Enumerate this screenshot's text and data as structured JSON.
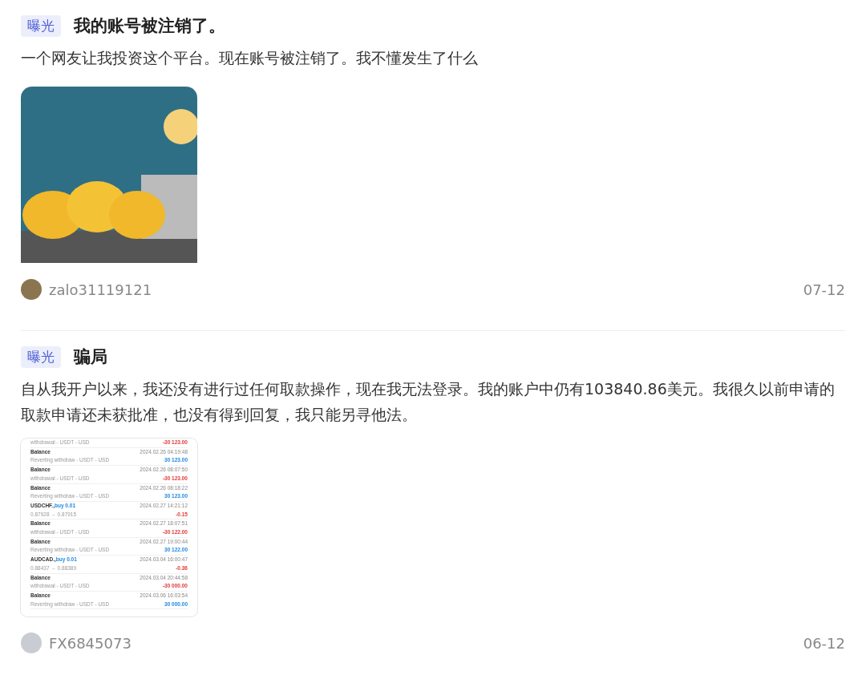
{
  "posts": [
    {
      "tag": "曝光",
      "title": "我的账号被注销了。",
      "body": "一个网友让我投资这个平台。现在账号被注销了。我不懂发生了什么",
      "author": "zalo31119121",
      "date": "07-12"
    },
    {
      "tag": "曝光",
      "title": "骗局",
      "body": "自从我开户以来，我还没有进行过任何取款操作，现在我无法登录。我的账户中仍有103840.86美元。我很久以前申请的取款申请还未获批准，也没有得到回复，我只能另寻他法。",
      "transactions": [
        {
          "subtitle": "withdrawal - USDT - USD",
          "amount": "-30 123.00",
          "kind": "debit"
        },
        {
          "title": "Balance",
          "date": "2024.02.26 04:19:48",
          "subtitle": "Reverting withdraw - USDT - USD",
          "amount": "30 123.00",
          "kind": "credit"
        },
        {
          "title": "Balance",
          "date": "2024.02.26 08:07:50",
          "subtitle": "withdrawal - USDT - USD",
          "amount": "-30 123.00",
          "kind": "debit"
        },
        {
          "title": "Balance",
          "date": "2024.02.26 08:18:22",
          "subtitle": "Reverting withdraw - USDT - USD",
          "amount": "30 123.00",
          "kind": "credit"
        },
        {
          "title": "USDCHF.,",
          "trade": "buy 0.01",
          "date": "2024.02.27 14:21:12",
          "subtitle": "0.87928 → 0.87915",
          "amount": "-0.15",
          "kind": "debit"
        },
        {
          "title": "Balance",
          "date": "2024.02.27 18:07:51",
          "subtitle": "withdrawal - USDT - USD",
          "amount": "-30 122.00",
          "kind": "debit"
        },
        {
          "title": "Balance",
          "date": "2024.02.27 19:00:44",
          "subtitle": "Reverting withdraw - USDT - USD",
          "amount": "30 122.00",
          "kind": "credit"
        },
        {
          "title": "AUDCAD.,",
          "trade": "buy 0.01",
          "date": "2024.03.04 16:00:47",
          "subtitle": "0.88437 → 0.88389",
          "amount": "-0.36",
          "kind": "debit"
        },
        {
          "title": "Balance",
          "date": "2024.03.04 20:44:58",
          "subtitle": "withdrawal - USDT - USD",
          "amount": "-30 000.00",
          "kind": "debit"
        },
        {
          "title": "Balance",
          "date": "2024.03.06 16:03:54",
          "subtitle": "Reverting withdraw - USDT - USD",
          "amount": "30 000.00",
          "kind": "credit"
        }
      ],
      "author": "FX6845073",
      "date": "06-12"
    }
  ]
}
